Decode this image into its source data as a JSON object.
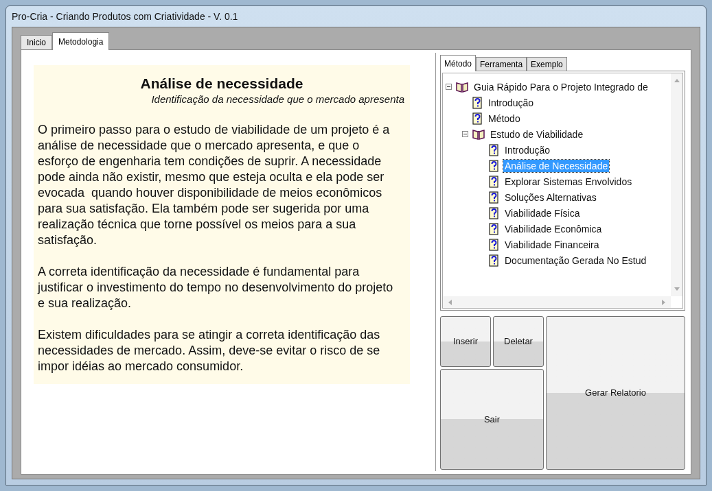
{
  "window": {
    "title": "Pro-Cria - Criando Produtos com Criatividade - V. 0.1"
  },
  "tabs": [
    {
      "label": "Inicio",
      "selected": false
    },
    {
      "label": "Metodologia",
      "selected": true
    }
  ],
  "article": {
    "title": "Análise de necessidade",
    "subtitle": "Identificação da necessidade que o mercado apresenta",
    "paragraphs": [
      "O primeiro passo para o estudo de viabilidade de um projeto é a análise de necessidade que o mercado apresenta, e que o esforço de engenharia tem condições de suprir. A necessidade pode ainda não existir, mesmo que esteja oculta e ela pode ser evocada  quando houver disponibilidade de meios econômicos para sua satisfação. Ela também pode ser sugerida por uma realização técnica que torne possível os meios para a sua satisfação.",
      "A correta identificação da necessidade é fundamental para justificar o investimento do tempo no desenvolvimento do projeto e sua realização.",
      "Existem dificuldades para se atingir a correta identificação das necessidades de mercado. Assim, deve-se evitar o risco de se impor idéias ao mercado consumidor."
    ]
  },
  "side_tabs": [
    {
      "label": "Método",
      "selected": true
    },
    {
      "label": "Ferramenta",
      "selected": false
    },
    {
      "label": "Exemplo",
      "selected": false
    }
  ],
  "tree": [
    {
      "kind": "book",
      "label": "Guia Rápido Para o Projeto Integrado de",
      "expanded": true,
      "selected": false,
      "children": [
        {
          "kind": "page",
          "label": "Introdução",
          "selected": false
        },
        {
          "kind": "page",
          "label": "Método",
          "selected": false
        },
        {
          "kind": "book",
          "label": "Estudo de Viabilidade",
          "expanded": true,
          "selected": false,
          "children": [
            {
              "kind": "page",
              "label": "Introdução",
              "selected": false
            },
            {
              "kind": "page",
              "label": "Análise de Necessidade",
              "selected": true
            },
            {
              "kind": "page",
              "label": "Explorar Sistemas Envolvidos",
              "selected": false
            },
            {
              "kind": "page",
              "label": "Soluções Alternativas",
              "selected": false
            },
            {
              "kind": "page",
              "label": "Viabilidade Física",
              "selected": false
            },
            {
              "kind": "page",
              "label": "Viabilidade Econômica",
              "selected": false
            },
            {
              "kind": "page",
              "label": "Viabilidade Financeira",
              "selected": false
            },
            {
              "kind": "page",
              "label": "Documentação Gerada No Estud",
              "selected": false
            }
          ]
        }
      ]
    }
  ],
  "buttons": {
    "insert": "Inserir",
    "delete": "Deletar",
    "exit": "Sair",
    "report": "Gerar Relatorio"
  }
}
